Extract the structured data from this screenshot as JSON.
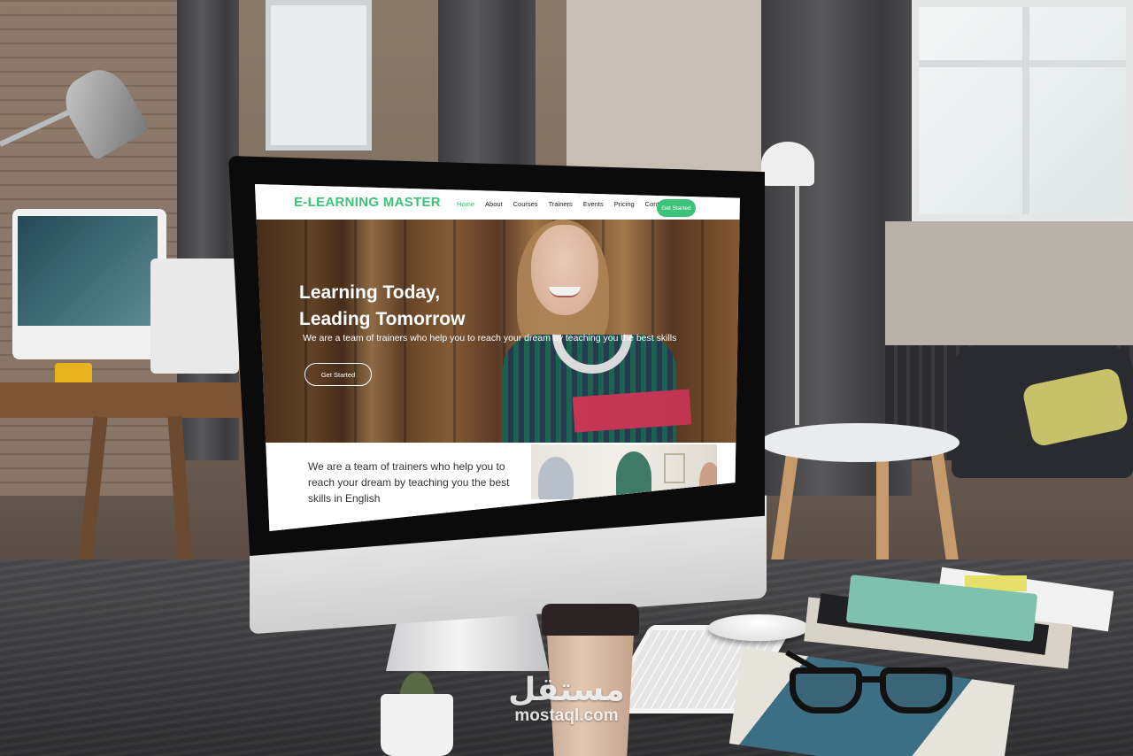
{
  "site": {
    "logo": "E-LEARNING MASTER",
    "nav": [
      "Home",
      "About",
      "Courses",
      "Trainers",
      "Events",
      "Pricing",
      "Contact"
    ],
    "active_nav": "Home",
    "nav_cta": "Get Started",
    "accent_color": "#3cc37a"
  },
  "hero": {
    "title_line1": "Learning Today,",
    "title_line2": "Leading Tomorrow",
    "subtitle": "We are a team of trainers who help you to reach your dream by teaching you the best skills",
    "cta": "Get Started"
  },
  "about": {
    "text": "We are a team of trainers who help you to reach your dream by teaching you the best skills in English"
  },
  "watermark": {
    "arabic": "مستقل",
    "domain": "mostaql.com"
  }
}
